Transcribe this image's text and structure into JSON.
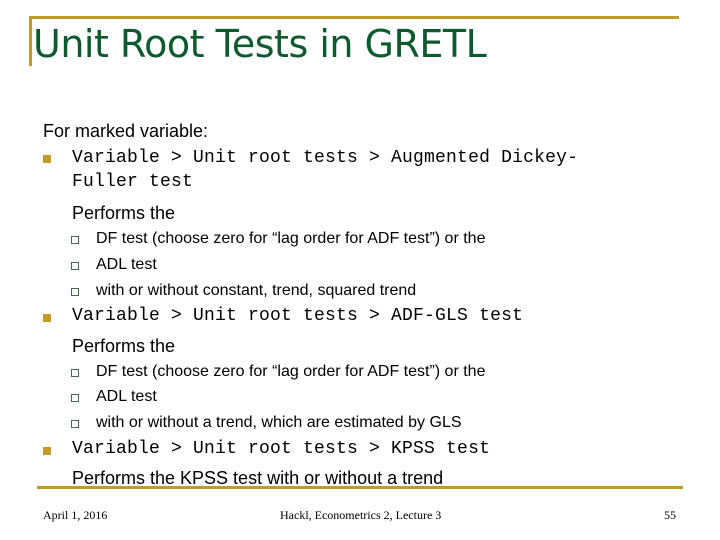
{
  "slide": {
    "title": "Unit Root Tests in GRETL",
    "intro": "For marked variable:",
    "items": [
      {
        "menu_path": "Variable > Unit root tests > Augmented Dickey-",
        "menu_path_cont": "Fuller test",
        "description": "Performs the",
        "subitems": [
          "DF test (choose zero for “lag order for ADF test”) or the",
          "ADL test",
          "with or without constant, trend, squared trend"
        ]
      },
      {
        "menu_path": "Variable > Unit root tests > ADF-GLS test",
        "description": "Performs the",
        "subitems": [
          "DF test (choose zero for “lag order for ADF test”) or the",
          "ADL test",
          "with or without a trend, which are estimated by GLS"
        ]
      },
      {
        "menu_path": "Variable > Unit root tests > KPSS test",
        "description": "Performs the KPSS test with or without a trend"
      }
    ]
  },
  "footer": {
    "date": "April 1, 2016",
    "center": "Hackl, Econometrics 2, Lecture 3",
    "page_number": "55"
  },
  "colors": {
    "title": "#0d5a2e",
    "accent": "#c09a2c"
  }
}
